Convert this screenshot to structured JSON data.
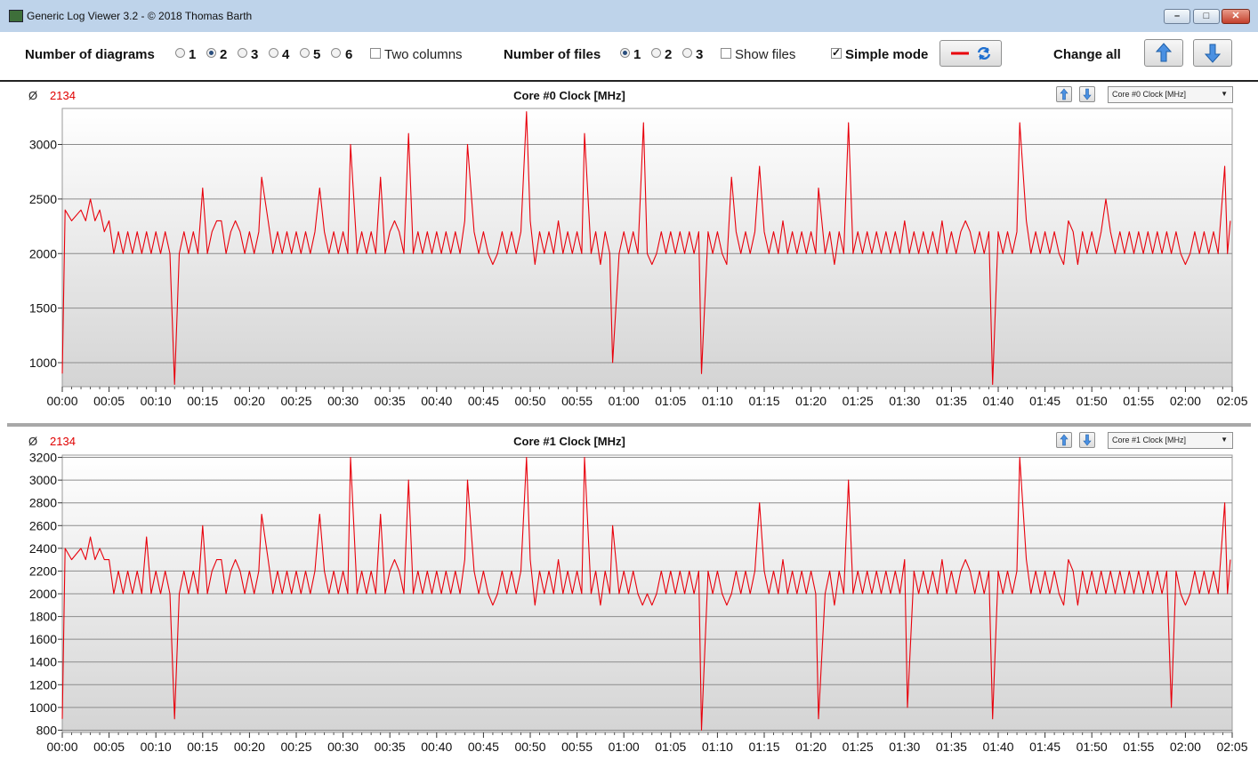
{
  "window": {
    "title": "Generic Log Viewer 3.2 - © 2018 Thomas Barth",
    "minimize": "–",
    "maximize": "□",
    "close": "✕"
  },
  "toolbar": {
    "num_diagrams_label": "Number of diagrams",
    "diagram_options": [
      "1",
      "2",
      "3",
      "4",
      "5",
      "6"
    ],
    "diagram_selected": "2",
    "two_columns_label": "Two columns",
    "two_columns_checked": false,
    "num_files_label": "Number of files",
    "file_options": [
      "1",
      "2",
      "3"
    ],
    "file_selected": "1",
    "show_files_label": "Show files",
    "show_files_checked": false,
    "simple_mode_label": "Simple mode",
    "simple_mode_checked": true,
    "change_all_label": "Change all",
    "line_color": "#e8000b"
  },
  "panels": [
    {
      "avg_symbol": "Ø",
      "avg_value": "2134",
      "title": "Core #0 Clock [MHz]",
      "select_value": "Core #0 Clock [MHz]",
      "yticks": [
        1000,
        1500,
        2000,
        2500,
        3000
      ]
    },
    {
      "avg_symbol": "Ø",
      "avg_value": "2134",
      "title": "Core #1 Clock [MHz]",
      "select_value": "Core #1 Clock [MHz]",
      "yticks": [
        800,
        1000,
        1200,
        1400,
        1600,
        1800,
        2000,
        2200,
        2400,
        2600,
        2800,
        3000,
        3200
      ]
    }
  ],
  "chart_data": [
    {
      "type": "line",
      "title": "Core #0 Clock [MHz]",
      "xlim": [
        0,
        125
      ],
      "ylim": [
        780,
        3330
      ],
      "xticks": [
        "00:00",
        "00:05",
        "00:10",
        "00:15",
        "00:20",
        "00:25",
        "00:30",
        "00:35",
        "00:40",
        "00:45",
        "00:50",
        "00:55",
        "01:00",
        "01:05",
        "01:10",
        "01:15",
        "01:20",
        "01:25",
        "01:30",
        "01:35",
        "01:40",
        "01:45",
        "01:50",
        "01:55",
        "02:00",
        "02:05"
      ],
      "baseline": [
        2000,
        2200
      ],
      "start_values": [
        [
          0,
          900
        ],
        [
          0.3,
          2400
        ],
        [
          1,
          2300
        ],
        [
          2,
          2400
        ],
        [
          2.5,
          2300
        ],
        [
          3,
          2500
        ],
        [
          3.5,
          2300
        ],
        [
          4,
          2400
        ],
        [
          4.5,
          2200
        ],
        [
          5,
          2300
        ]
      ],
      "spikes": [
        [
          12.0,
          800
        ],
        [
          15.0,
          2600
        ],
        [
          21.3,
          2700
        ],
        [
          27.5,
          2600
        ],
        [
          30.8,
          3000
        ],
        [
          34.0,
          2700
        ],
        [
          37.0,
          3100
        ],
        [
          43.3,
          3000
        ],
        [
          49.6,
          3300
        ],
        [
          55.8,
          3100
        ],
        [
          58.8,
          1000
        ],
        [
          62.1,
          3200
        ],
        [
          68.3,
          900
        ],
        [
          71.5,
          2700
        ],
        [
          74.5,
          2800
        ],
        [
          80.8,
          2600
        ],
        [
          84.0,
          3200
        ],
        [
          99.4,
          800
        ],
        [
          102.3,
          3200
        ],
        [
          111.5,
          2500
        ],
        [
          124.2,
          2800
        ]
      ],
      "end_value": 2300,
      "series": [
        {
          "color": "#e8000b"
        }
      ]
    },
    {
      "type": "line",
      "title": "Core #1 Clock [MHz]",
      "xlim": [
        0,
        125
      ],
      "ylim": [
        780,
        3220
      ],
      "xticks": [
        "00:00",
        "00:05",
        "00:10",
        "00:15",
        "00:20",
        "00:25",
        "00:30",
        "00:35",
        "00:40",
        "00:45",
        "00:50",
        "00:55",
        "01:00",
        "01:05",
        "01:10",
        "01:15",
        "01:20",
        "01:25",
        "01:30",
        "01:35",
        "01:40",
        "01:45",
        "01:50",
        "01:55",
        "02:00",
        "02:05"
      ],
      "baseline": [
        2000,
        2200
      ],
      "start_values": [
        [
          0,
          900
        ],
        [
          0.3,
          2400
        ],
        [
          1,
          2300
        ],
        [
          2,
          2400
        ],
        [
          2.5,
          2300
        ],
        [
          3,
          2500
        ],
        [
          3.5,
          2300
        ],
        [
          4,
          2400
        ],
        [
          4.5,
          2300
        ],
        [
          5,
          2300
        ]
      ],
      "spikes": [
        [
          9.0,
          2500
        ],
        [
          12.0,
          900
        ],
        [
          15.0,
          2600
        ],
        [
          21.3,
          2700
        ],
        [
          27.5,
          2700
        ],
        [
          30.8,
          3200
        ],
        [
          34.0,
          2700
        ],
        [
          37.0,
          3000
        ],
        [
          43.3,
          3000
        ],
        [
          49.6,
          3200
        ],
        [
          55.8,
          3200
        ],
        [
          58.8,
          2600
        ],
        [
          68.3,
          800
        ],
        [
          74.5,
          2800
        ],
        [
          80.8,
          900
        ],
        [
          84.0,
          3000
        ],
        [
          90.3,
          1000
        ],
        [
          99.4,
          900
        ],
        [
          102.3,
          3200
        ],
        [
          118.5,
          1000
        ],
        [
          124.2,
          2800
        ]
      ],
      "end_value": 2300,
      "series": [
        {
          "color": "#e8000b"
        }
      ]
    }
  ]
}
